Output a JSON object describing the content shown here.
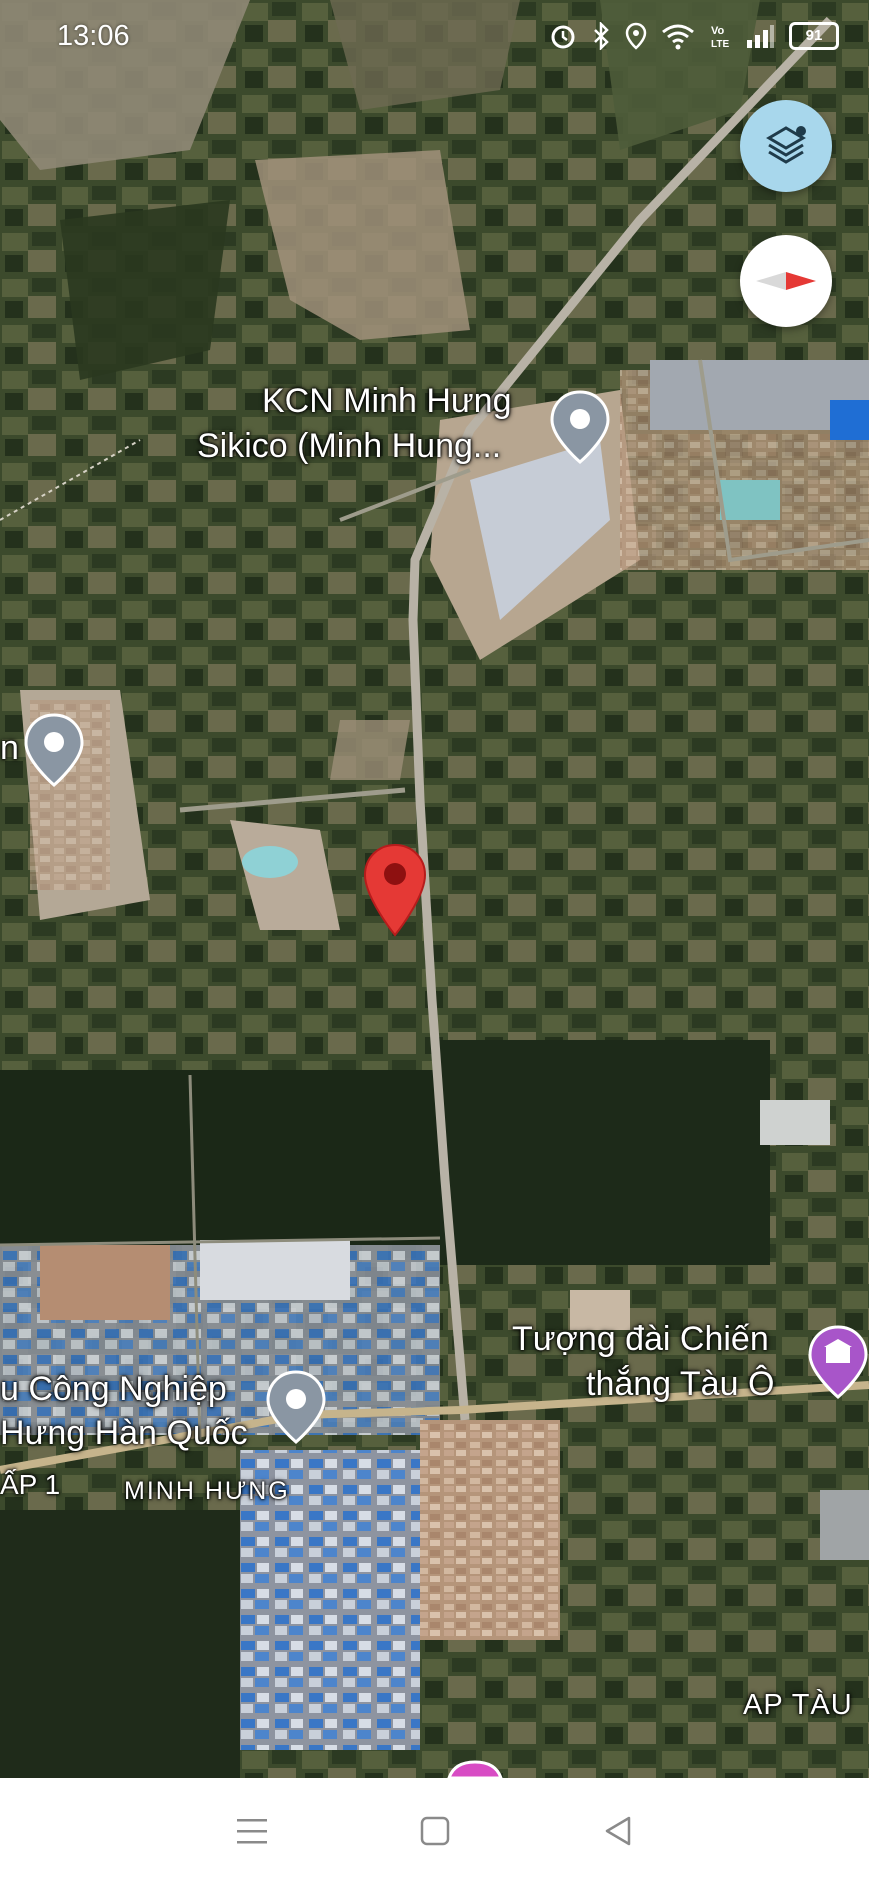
{
  "status_bar": {
    "time": "13:06",
    "battery_level": "91",
    "icons": [
      "alarm-icon",
      "bluetooth-icon",
      "location-icon",
      "wifi-icon",
      "volte-icon",
      "signal-icon",
      "battery-icon"
    ]
  },
  "map": {
    "type": "satellite",
    "labels": {
      "kcn_line1": "KCN Minh Hưng",
      "kcn_line2": "Sikico (Minh Hung...",
      "korea_line1": "u Công Nghiệp",
      "korea_line2": "Hưng Hàn Quốc",
      "monument_line1": "Tượng đài Chiến",
      "monument_line2": "thắng Tàu Ô",
      "ap1": "ẤP 1",
      "minh_hung": "MINH HƯNG",
      "ap_tau": "AP TÀU",
      "edge_n": "n"
    }
  },
  "controls": {
    "layers_icon": "layers-icon",
    "compass_icon": "compass-icon"
  },
  "colors": {
    "dropped_pin": "#e53935",
    "place_pin": "#8a96a3",
    "monument_pin": "#a855c9",
    "layers_button": "#a8d7ec"
  },
  "navbar": {
    "icons": [
      "menu-icon",
      "home-icon",
      "back-icon"
    ]
  }
}
